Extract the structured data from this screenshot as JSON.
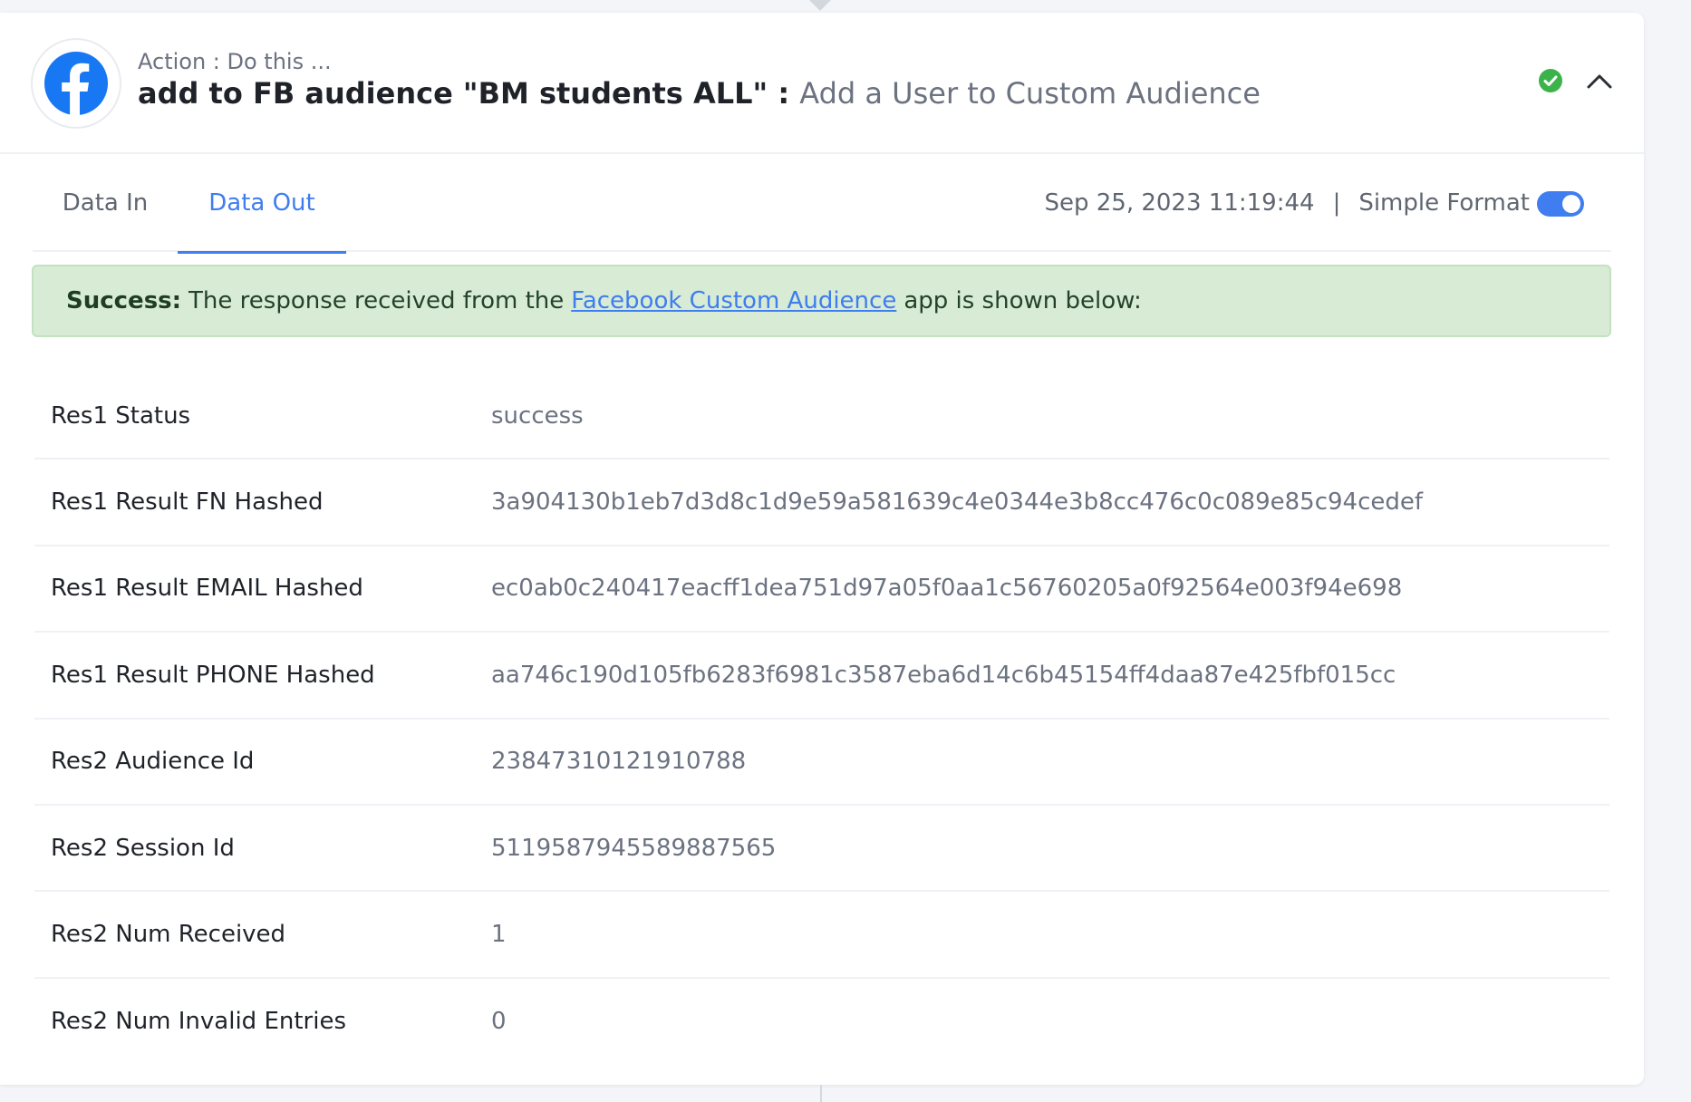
{
  "header": {
    "step_label": "Action : Do this ...",
    "step_name": "add to FB audience \"BM students ALL\"",
    "separator": " : ",
    "event_name": "Add a User to Custom Audience",
    "app_icon": "facebook-logo-icon",
    "status_icon": "check-circle-icon",
    "collapse_icon": "chevron-up-icon"
  },
  "tabs": {
    "data_in": "Data In",
    "data_out": "Data Out",
    "active": "Data Out"
  },
  "meta": {
    "timestamp": "Sep 25, 2023 11:19:44",
    "separator": "|",
    "format_label": "Simple Format",
    "simple_format_on": true
  },
  "banner": {
    "prefix": "Success:",
    "text_before": "The response received from the",
    "link": "Facebook Custom Audience",
    "text_after": "app is shown below:"
  },
  "rows": [
    {
      "key": "Res1 Status",
      "value": "success"
    },
    {
      "key": "Res1 Result FN Hashed",
      "value": "3a904130b1eb7d3d8c1d9e59a581639c4e0344e3b8cc476c0c089e85c94cedef"
    },
    {
      "key": "Res1 Result EMAIL Hashed",
      "value": "ec0ab0c240417eacff1dea751d97a05f0aa1c56760205a0f92564e003f94e698"
    },
    {
      "key": "Res1 Result PHONE Hashed",
      "value": "aa746c190d105fb6283f6981c3587eba6d14c6b45154ff4daa87e425fbf015cc"
    },
    {
      "key": "Res2 Audience Id",
      "value": "23847310121910788"
    },
    {
      "key": "Res2 Session Id",
      "value": "5119587945589887565"
    },
    {
      "key": "Res2 Num Received",
      "value": "1"
    },
    {
      "key": "Res2 Num Invalid Entries",
      "value": "0"
    }
  ],
  "colors": {
    "accent": "#3f7df0",
    "success_bg": "#d7ebd5",
    "success_icon": "#3cb34a",
    "facebook_blue": "#1877f2"
  }
}
